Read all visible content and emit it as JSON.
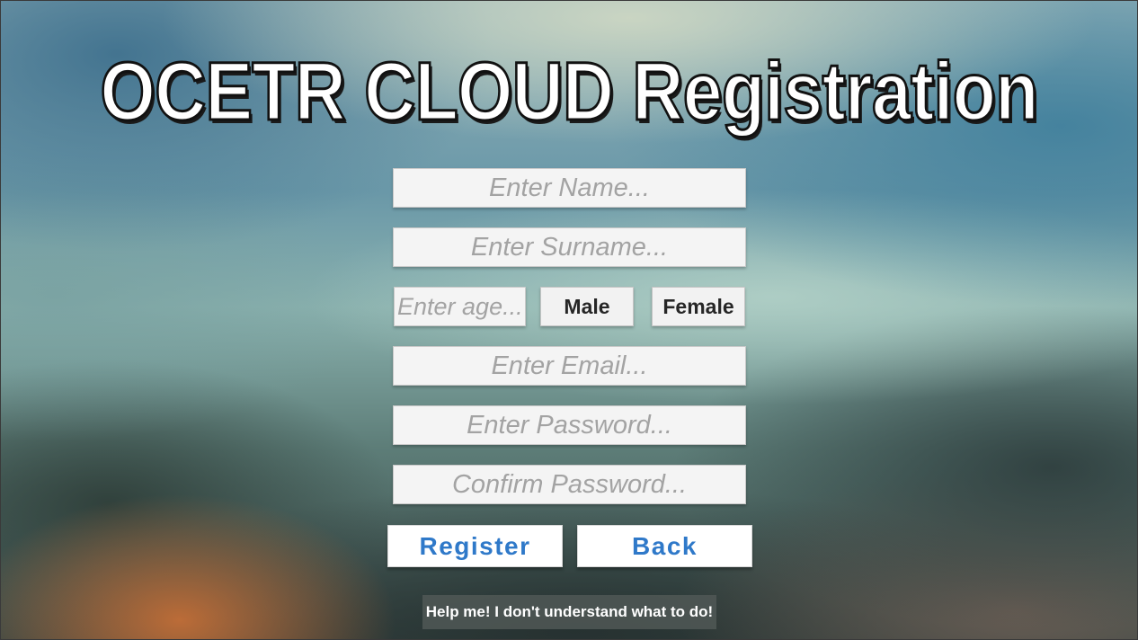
{
  "title": "OCETR CLOUD Registration",
  "form": {
    "name_placeholder": "Enter Name...",
    "surname_placeholder": "Enter Surname...",
    "age_placeholder": "Enter age...",
    "male_label": "Male",
    "female_label": "Female",
    "email_placeholder": "Enter Email...",
    "password_placeholder": "Enter Password...",
    "confirm_password_placeholder": "Confirm Password..."
  },
  "actions": {
    "register_label": "Register",
    "back_label": "Back"
  },
  "help_label": "Help me! I don't understand what to do!",
  "colors": {
    "button_text": "#2f79c9",
    "placeholder_text": "#a3a3a3",
    "field_background": "#f4f4f4"
  }
}
